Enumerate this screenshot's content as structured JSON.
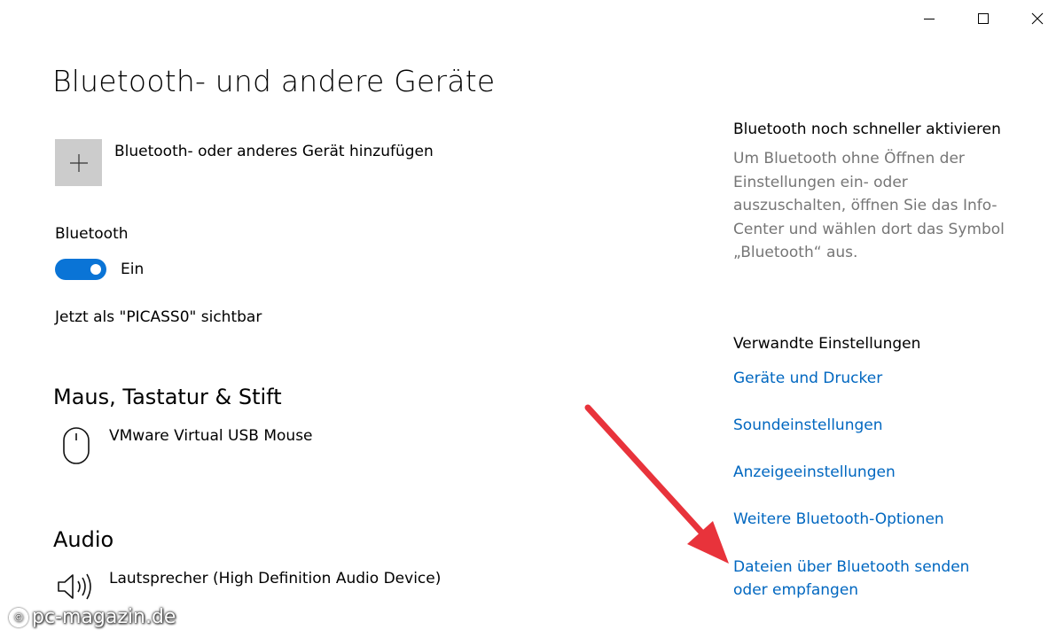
{
  "window": {
    "controls": [
      "minimize",
      "maximize",
      "close"
    ]
  },
  "page": {
    "title": "Bluetooth- und andere Geräte"
  },
  "add_device": {
    "label": "Bluetooth- oder anderes Gerät hinzufügen",
    "icon": "plus-icon"
  },
  "bluetooth": {
    "label": "Bluetooth",
    "toggle_state": "Ein",
    "toggle_on": true,
    "visible_as": "Jetzt als \"PICASS0\" sichtbar",
    "accent_color": "#0a74d6"
  },
  "sections": {
    "mouse": {
      "title": "Maus, Tastatur & Stift",
      "device": "VMware Virtual USB Mouse",
      "icon": "mouse-icon"
    },
    "audio": {
      "title": "Audio",
      "device": "Lautsprecher (High Definition Audio Device)",
      "icon": "speaker-icon"
    }
  },
  "side": {
    "heading": "Bluetooth noch schneller aktivieren",
    "text": "Um Bluetooth ohne Öffnen der Einstellungen ein- oder auszuschalten, öffnen Sie das Info-Center und wählen dort das Symbol „Bluetooth“ aus."
  },
  "related": {
    "heading": "Verwandte Einstellungen",
    "links": [
      "Geräte und Drucker",
      "Soundeinstellungen",
      "Anzeigeeinstellungen",
      "Weitere Bluetooth-Optionen",
      "Dateien über Bluetooth senden oder empfangen"
    ],
    "link_color": "#0067c0"
  },
  "annotation": {
    "arrow_color": "#e8333b"
  },
  "watermark": {
    "text": "pc-magazin.de"
  }
}
